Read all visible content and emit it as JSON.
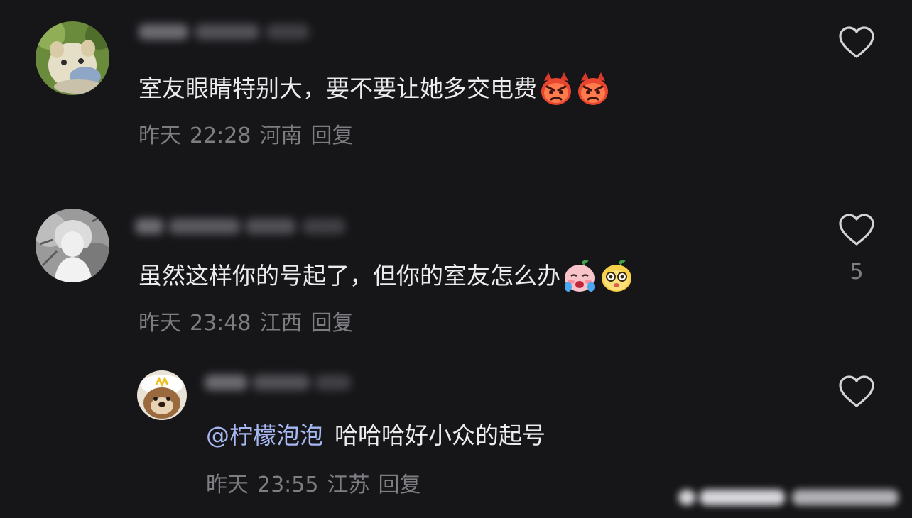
{
  "comments": [
    {
      "text": "室友眼睛特别大，要不要让她多交电费",
      "emojis": [
        "angry-devil-emoji",
        "angry-devil-emoji"
      ],
      "meta": {
        "time": "昨天",
        "clock": "22:28",
        "location": "河南",
        "reply": "回复"
      },
      "likes": ""
    },
    {
      "text": "虽然这样你的号起了，但你的室友怎么办",
      "emojis": [
        "crying-emoji",
        "dizzy-face-emoji"
      ],
      "meta": {
        "time": "昨天",
        "clock": "23:48",
        "location": "江西",
        "reply": "回复"
      },
      "likes": "5"
    }
  ],
  "replies": [
    {
      "mention": "@柠檬泡泡",
      "text": "哈哈哈好小众的起号",
      "meta": {
        "time": "昨天",
        "clock": "23:55",
        "location": "江苏",
        "reply": "回复"
      },
      "likes": ""
    }
  ],
  "icons": {
    "like": "heart-outline-icon"
  },
  "colors": {
    "background": "#161619",
    "text": "#ececec",
    "meta": "#7d7d82",
    "mention": "#a8b9f2"
  }
}
